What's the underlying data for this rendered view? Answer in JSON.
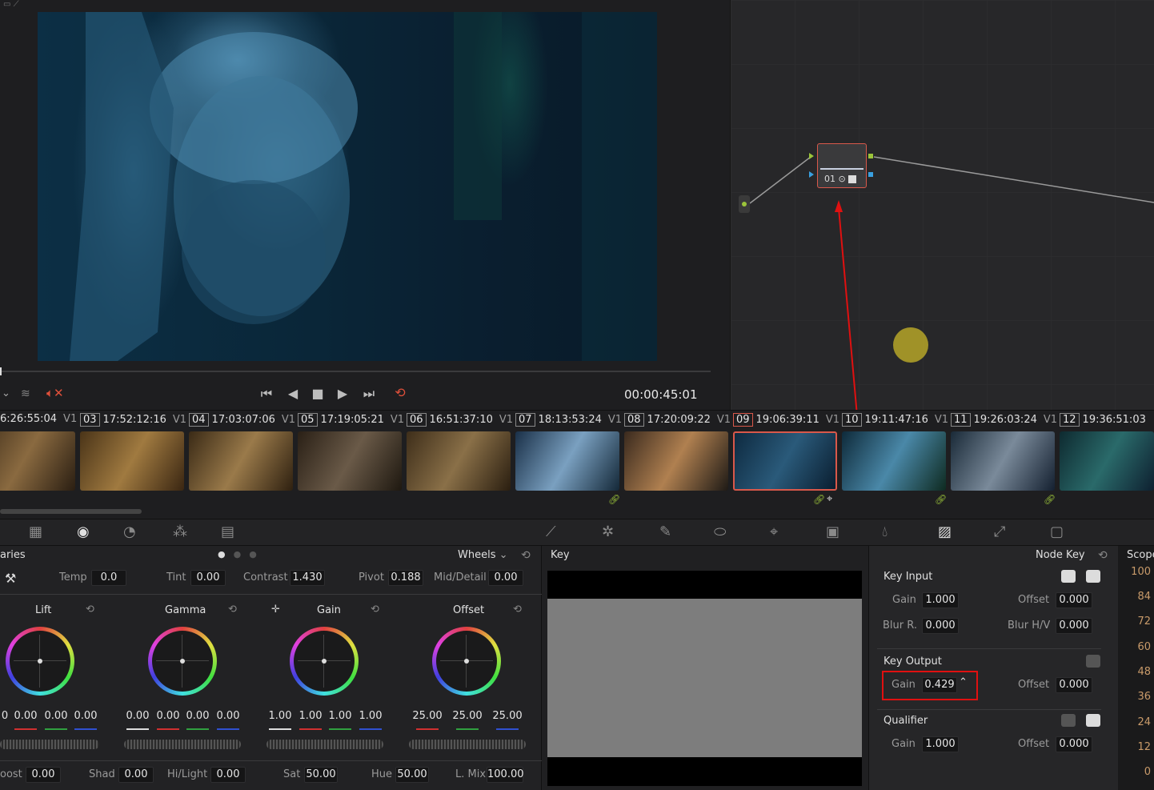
{
  "viewer": {
    "timecode": "00:00:45:01"
  },
  "node_editor": {
    "node_label": "01"
  },
  "clips": [
    {
      "tc": "6:26:55:04",
      "track": "V1"
    },
    {
      "num": "03",
      "tc": "17:52:12:16",
      "track": "V1"
    },
    {
      "num": "04",
      "tc": "17:03:07:06",
      "track": "V1"
    },
    {
      "num": "05",
      "tc": "17:19:05:21",
      "track": "V1"
    },
    {
      "num": "06",
      "tc": "16:51:37:10",
      "track": "V1"
    },
    {
      "num": "07",
      "tc": "18:13:53:24",
      "track": "V1"
    },
    {
      "num": "08",
      "tc": "17:20:09:22",
      "track": "V1"
    },
    {
      "num": "09",
      "tc": "19:06:39:11",
      "track": "V1"
    },
    {
      "num": "10",
      "tc": "19:11:47:16",
      "track": "V1"
    },
    {
      "num": "11",
      "tc": "19:26:03:24",
      "track": "V1"
    },
    {
      "num": "12",
      "tc": "19:36:51:03",
      "track": ""
    }
  ],
  "wheels_panel": {
    "title_left": "aries",
    "mode": "Wheels",
    "temp_label": "Temp",
    "temp": "0.0",
    "tint_label": "Tint",
    "tint": "0.00",
    "contrast_label": "Contrast",
    "contrast": "1.430",
    "pivot_label": "Pivot",
    "pivot": "0.188",
    "middetail_label": "Mid/Detail",
    "middetail": "0.00",
    "lift": {
      "label": "Lift",
      "values": [
        "0",
        "0.00",
        "0.00",
        "0.00"
      ]
    },
    "gamma": {
      "label": "Gamma",
      "values": [
        "0.00",
        "0.00",
        "0.00",
        "0.00"
      ]
    },
    "gain": {
      "label": "Gain",
      "values": [
        "1.00",
        "1.00",
        "1.00",
        "1.00"
      ]
    },
    "offset": {
      "label": "Offset",
      "values": [
        "25.00",
        "25.00",
        "25.00"
      ]
    },
    "boost_label": "oost",
    "boost": "0.00",
    "shad_label": "Shad",
    "shad": "0.00",
    "hilight_label": "Hi/Light",
    "hilight": "0.00",
    "sat_label": "Sat",
    "sat": "50.00",
    "hue_label": "Hue",
    "hue": "50.00",
    "lmix_label": "L. Mix",
    "lmix": "100.00"
  },
  "key_panel": {
    "title": "Key"
  },
  "node_key": {
    "title": "Node Key",
    "key_input": {
      "label": "Key Input",
      "gain_label": "Gain",
      "gain": "1.000",
      "offset_label": "Offset",
      "offset": "0.000",
      "blur_r_label": "Blur R.",
      "blur_r": "0.000",
      "blur_hv_label": "Blur H/V",
      "blur_hv": "0.000"
    },
    "key_output": {
      "label": "Key Output",
      "gain_label": "Gain",
      "gain": "0.429",
      "offset_label": "Offset",
      "offset": "0.000"
    },
    "qualifier": {
      "label": "Qualifier",
      "gain_label": "Gain",
      "gain": "1.000",
      "offset_label": "Offset",
      "offset": "0.000"
    }
  },
  "scopes": {
    "title": "Scope",
    "scale": [
      "100",
      "84",
      "72",
      "60",
      "48",
      "36",
      "24",
      "12",
      "0"
    ]
  },
  "colors": {
    "highlight": "#e01010",
    "accent": "#d9584a"
  }
}
